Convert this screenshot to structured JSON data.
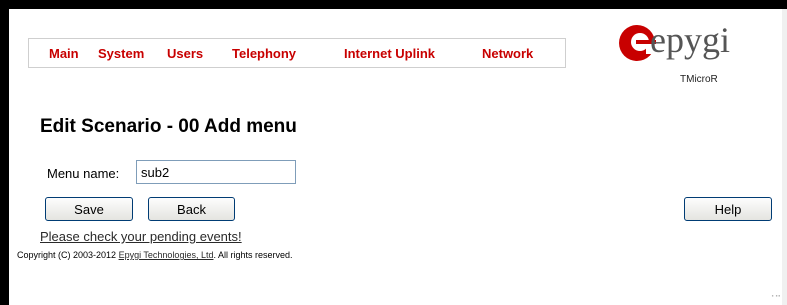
{
  "nav": {
    "items": [
      "Main",
      "System",
      "Users",
      "Telephony",
      "Internet Uplink",
      "Network"
    ]
  },
  "logo": {
    "brand": "epygi",
    "model": "TMicroR",
    "accent_color": "#c80000"
  },
  "page": {
    "title": "Edit Scenario - 00 Add menu"
  },
  "form": {
    "menu_name_label": "Menu name:",
    "menu_name_value": "sub2"
  },
  "buttons": {
    "save": "Save",
    "back": "Back",
    "help": "Help"
  },
  "links": {
    "pending_events": "Please check your pending events!"
  },
  "footer": {
    "copyright_prefix": "Copyright (C) 2003-2012 ",
    "company": "Epygi Technologies, Ltd",
    "copyright_suffix": ". All rights reserved."
  }
}
